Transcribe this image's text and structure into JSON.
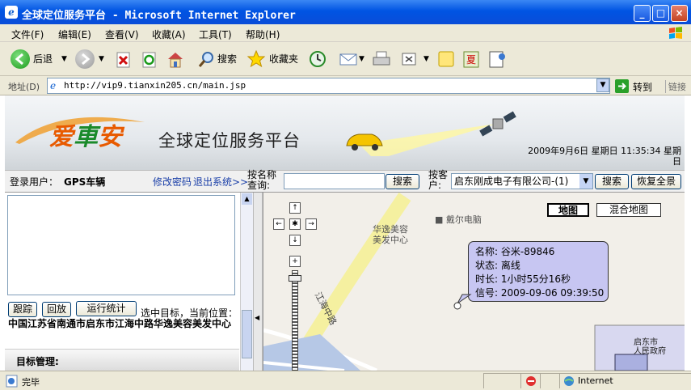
{
  "window": {
    "title": "全球定位服务平台 - Microsoft Internet Explorer",
    "minimize": "_",
    "maximize": "□",
    "close": "×"
  },
  "menu": [
    "文件(F)",
    "编辑(E)",
    "查看(V)",
    "收藏(A)",
    "工具(T)",
    "帮助(H)"
  ],
  "toolbar": {
    "back_label": "后退",
    "search_label": "搜索",
    "favorites_label": "收藏夹"
  },
  "address": {
    "label": "地址(D)",
    "url": "http://vip9.tianxin205.cn/main.jsp",
    "go_label": "转到",
    "links_label": "链接"
  },
  "banner": {
    "logo_text_1": "爱",
    "logo_text_2": "車",
    "logo_text_3": "安",
    "title": "全球定位服务平台",
    "datetime_line1": "2009年9月6日 星期日 11:35:34 星期",
    "datetime_line2": "日"
  },
  "infobar": {
    "user_label": "登录用户：",
    "user_name": "GPS车辆",
    "change_password": "修改密码",
    "logout": "退出系统>>",
    "search_by_name_label_1": "按名称",
    "search_by_name_label_2": "查询:",
    "search_name_value": "",
    "search_button": "搜索",
    "search_by_customer_label_1": "按客",
    "search_by_customer_label_2": "户:",
    "customer_selected": "启东刚成电子有限公司-(1)",
    "search_button2": "搜索",
    "restore_button": "恢复全景"
  },
  "left": {
    "track_button": "跟踪",
    "playback_button": "回放",
    "stats_button": "运行统计",
    "selected_target_label": "选中目标，当前位置：",
    "location_text": "中国江苏省南通市启东市江海中路华逸美容美发中心",
    "target_management": "目标管理:"
  },
  "map": {
    "map_button": "地图",
    "hybrid_button": "混合地图",
    "poi_1": "戴尔电脑",
    "poi_2_line1": "华逸美容",
    "poi_2_line2": "美发中心",
    "road_label": "江海中路",
    "city_label_1": "启东市",
    "city_label_2": "人民政府",
    "popup": {
      "name": "名称: 谷米-89846",
      "status": "状态: 离线",
      "duration": "时长: 1小时55分16秒",
      "signal": "信号: 2009-09-06 09:39:50"
    }
  },
  "status": {
    "text": "完毕",
    "zone": "Internet"
  },
  "colors": {
    "title_bar": "#0054e3",
    "popup_bg": "#c7c6f2",
    "road": "#f5f0a0",
    "link": "#1a3fa8"
  }
}
